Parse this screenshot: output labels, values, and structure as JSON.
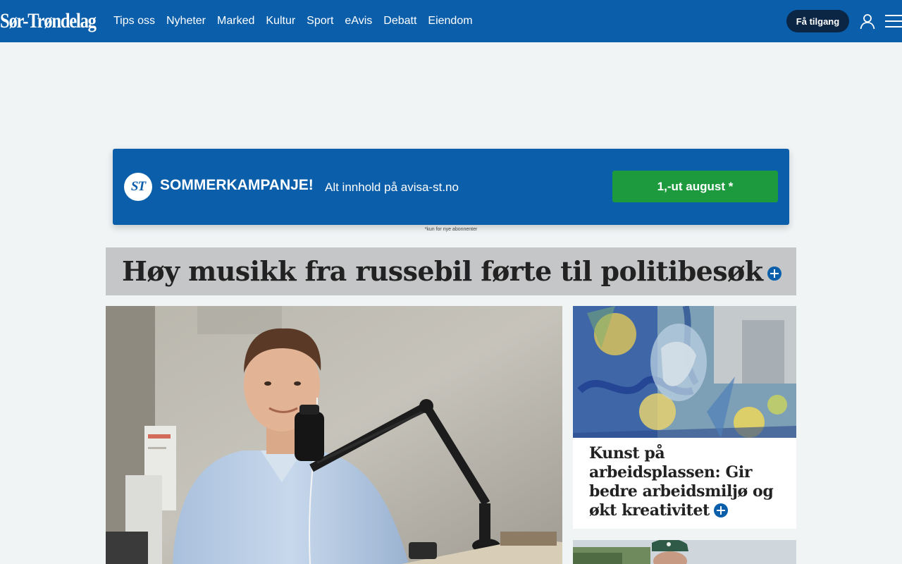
{
  "header": {
    "logo_text": "Sør-Trøndelag",
    "nav": [
      "Tips oss",
      "Nyheter",
      "Marked",
      "Kultur",
      "Sport",
      "eAvis",
      "Debatt",
      "Eiendom"
    ],
    "access_button": "Få tilgang",
    "icons": [
      "user-icon",
      "menu-icon"
    ]
  },
  "campaign": {
    "badge": "ST",
    "title": "SOMMERKAMPANJE!",
    "subtitle": "Alt innhold på avisa-st.no",
    "cta": "1,-ut august *",
    "note": "*kun for nye abonnenter"
  },
  "main_article": {
    "headline": "Høy musikk fra russebil førte til politibesøk"
  },
  "side_articles": [
    {
      "title": "Kunst på arbeidsplassen: Gir bedre arbeidsmiljø og økt kreativitet"
    }
  ],
  "colors": {
    "brand": "#0a5eaa",
    "dark_button": "#0b2545",
    "cta_green": "#1e9a3e",
    "page_bg": "#f0f4f5",
    "headline_box": "#c5c6c7"
  }
}
